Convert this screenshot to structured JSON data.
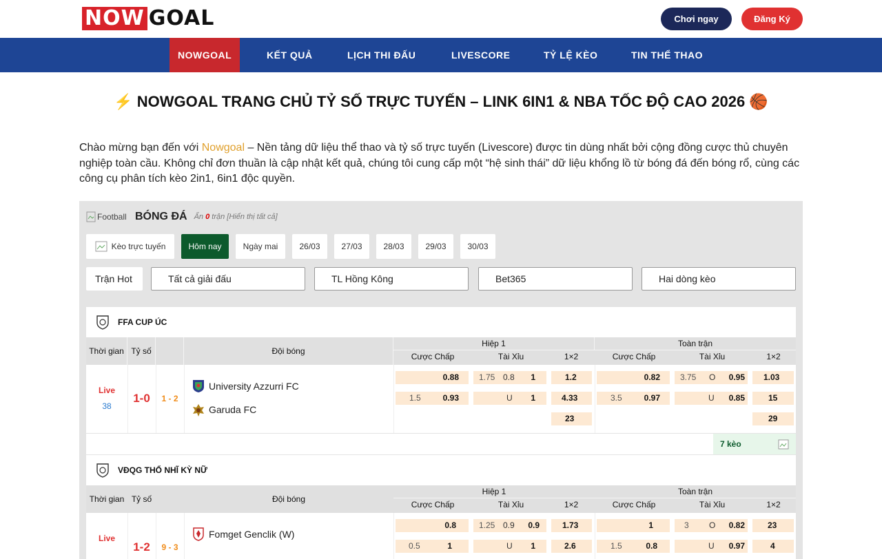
{
  "header": {
    "logo_now": "NOW",
    "logo_goal": "GOAL",
    "play_button": "Chơi ngay",
    "register_button": "Đăng Ký"
  },
  "nav": {
    "items": [
      "NOWGOAL",
      "KẾT QUẢ",
      "LỊCH THI ĐẤU",
      "LIVESCORE",
      "TỶ LỆ KÈO",
      "TIN THỂ THAO"
    ]
  },
  "page": {
    "title": "⚡ NOWGOAL TRANG CHỦ TỶ SỐ TRỰC TUYẾN – LINK 6IN1 & NBA TỐC ĐỘ CAO 2026 🏀",
    "intro_a": "Chào mừng bạn đến với ",
    "intro_brand": "Nowgoal",
    "intro_b": " – Nền tảng dữ liệu thể thao và tỷ số trực tuyến (Livescore) được tin dùng nhất bởi cộng đồng cược thủ chuyên nghiệp toàn cầu. Không chỉ đơn thuần là cập nhật kết quả, chúng tôi cung cấp một “hệ sinh thái” dữ liệu khổng lồ từ bóng đá đến bóng rổ, cùng các công cụ phân tích kèo 2in1, 6in1 độc quyền."
  },
  "panel": {
    "sport_img_alt": "Football",
    "sport_name": "BÓNG ĐÁ",
    "hidden_prefix": "Ẩn ",
    "hidden_count": "0",
    "hidden_suffix": " trận [Hiển thị tất cả]",
    "date_tabs": [
      "Kèo trực tuyến",
      "Hôm nay",
      "Ngày mai",
      "26/03",
      "27/03",
      "28/03",
      "29/03",
      "30/03"
    ],
    "filters": {
      "hot": "Trận Hot",
      "league": "Tất cả giải đấu",
      "timezone": "TL Hồng Kông",
      "bookmaker": "Bet365",
      "lines": "Hai dòng kèo"
    }
  },
  "table_headers": {
    "time": "Thời gian",
    "score": "Tỷ số",
    "teams": "Đội bóng",
    "half": "Hiệp 1",
    "full": "Toàn trận",
    "handicap": "Cược Chấp",
    "overunder": "Tài Xỉu",
    "x12": "1×2"
  },
  "matches": [
    {
      "league": "FFA CUP ÚC",
      "status": "Live",
      "minute": "38",
      "score": "1-0",
      "corners": "1 - 2",
      "home": "University Azzurri FC",
      "away": "Garuda FC",
      "h1_hdp": [
        [
          "",
          "0.88"
        ],
        [
          "1.5",
          "0.93"
        ]
      ],
      "h1_ou": [
        [
          "1.75",
          "0.8",
          "1"
        ],
        [
          "",
          "U",
          "1"
        ]
      ],
      "h1_x12": [
        "1.2",
        "4.33",
        "23"
      ],
      "ft_hdp": [
        [
          "",
          "0.82"
        ],
        [
          "3.5",
          "0.97"
        ]
      ],
      "ft_ou": [
        [
          "3.75",
          "O",
          "0.95"
        ],
        [
          "",
          "U",
          "0.85"
        ]
      ],
      "ft_x12": [
        "1.03",
        "15",
        "29"
      ],
      "more": "7 kèo"
    },
    {
      "league": "VĐQG THỔ NHĨ KỲ NỮ",
      "status": "Live",
      "minute": "",
      "score": "1-2",
      "corners": "9 - 3",
      "home": "Fomget Genclik (W)",
      "away": "",
      "h1_hdp": [
        [
          "",
          "0.8"
        ],
        [
          "0.5",
          "1"
        ]
      ],
      "h1_ou": [
        [
          "1.25",
          "0.9",
          "0.9"
        ],
        [
          "",
          "U",
          "1"
        ]
      ],
      "h1_x12": [
        "1.73",
        "2.6"
      ],
      "ft_hdp": [
        [
          "",
          "1"
        ],
        [
          "1.5",
          "0.8"
        ]
      ],
      "ft_ou": [
        [
          "3",
          "O",
          "0.82"
        ],
        [
          "",
          "U",
          "0.97"
        ]
      ],
      "ft_x12": [
        "23",
        "4"
      ]
    }
  ]
}
